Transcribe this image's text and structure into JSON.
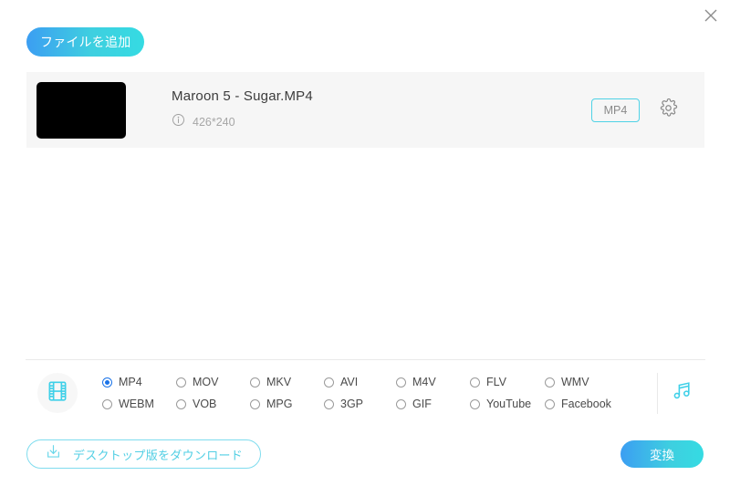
{
  "window": {
    "close_label": "×"
  },
  "toolbar": {
    "add_file_label": "ファイルを追加"
  },
  "file_list": [
    {
      "name": "Maroon 5 - Sugar.MP4",
      "resolution": "426*240",
      "format_badge": "MP4"
    }
  ],
  "format_bar": {
    "video_options": [
      "MP4",
      "MOV",
      "MKV",
      "AVI",
      "M4V",
      "FLV",
      "WMV",
      "WEBM",
      "VOB",
      "MPG",
      "3GP",
      "GIF",
      "YouTube",
      "Facebook"
    ],
    "selected_format": "MP4"
  },
  "footer": {
    "download_label": "デスクトップ版をダウンロード",
    "convert_label": "変換"
  },
  "colors": {
    "accent_cyan": "#4fd2e6",
    "accent_blue": "#3c9ef2",
    "radio_selected": "#1a73e8",
    "row_background": "#f6f6f6"
  }
}
